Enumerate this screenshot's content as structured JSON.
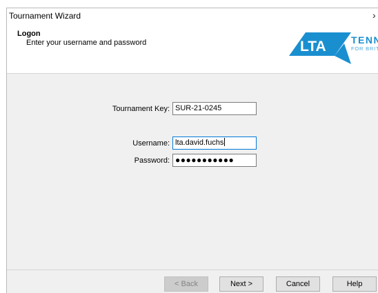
{
  "window": {
    "title": "Tournament Wizard",
    "close_glyph": "›"
  },
  "header": {
    "title": "Logon",
    "subtitle": "Enter your username and password",
    "logo": {
      "mark": "LTA",
      "text_main": "TENN",
      "text_sub": "FOR BRIT",
      "brand_color": "#1a8fd0"
    }
  },
  "form": {
    "tournament_key": {
      "label": "Tournament Key:",
      "value": "SUR-21-0245"
    },
    "username": {
      "label": "Username:",
      "value": "lta.david.fuchs"
    },
    "password": {
      "label": "Password:",
      "value_masked": "●●●●●●●●●●●"
    }
  },
  "buttons": {
    "back": "< Back",
    "next": "Next >",
    "cancel": "Cancel",
    "help": "Help"
  }
}
